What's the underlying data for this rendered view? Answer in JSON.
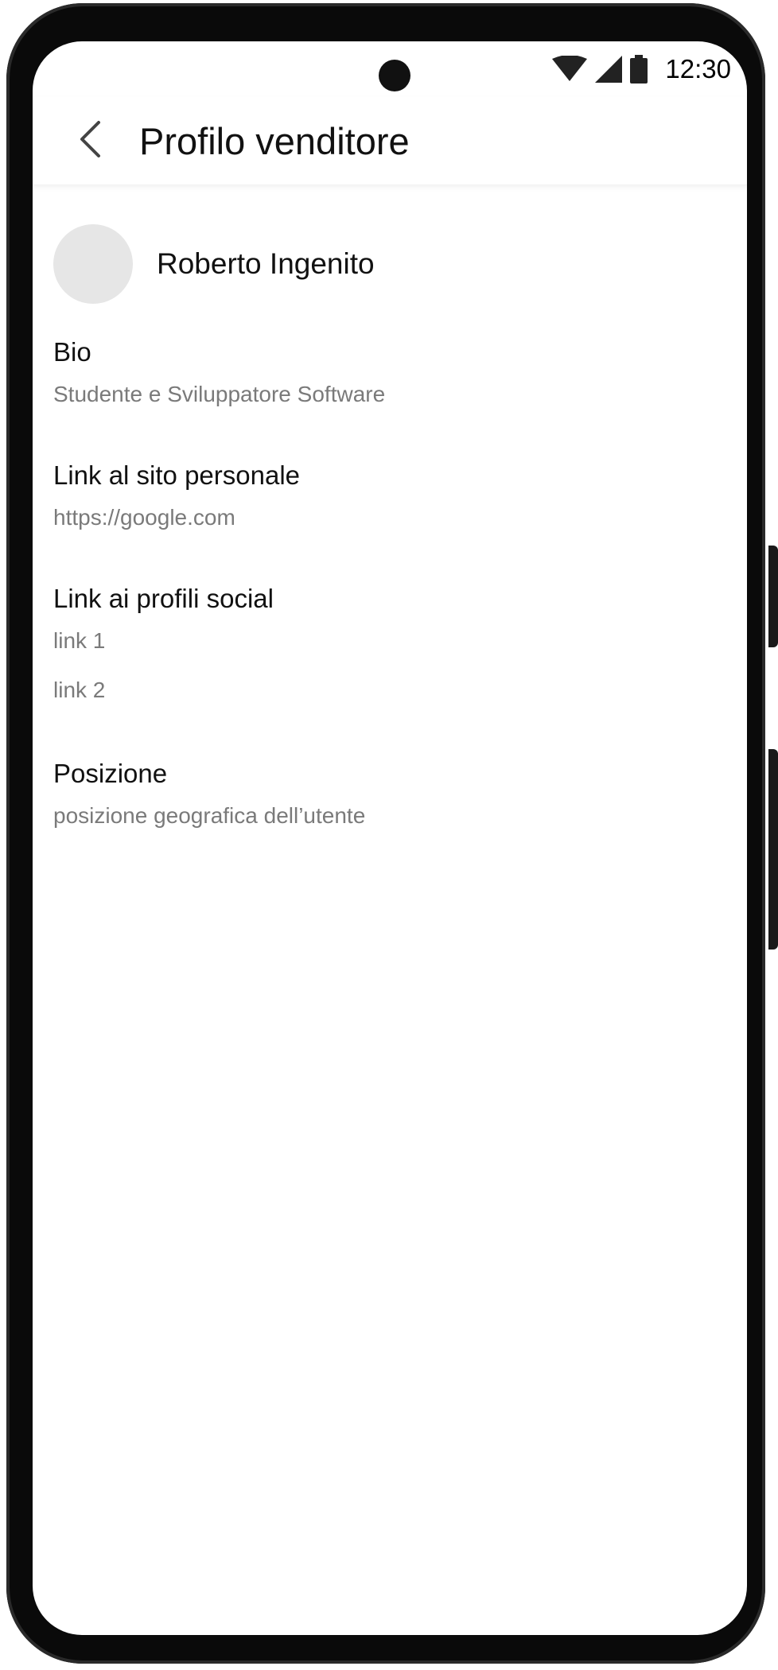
{
  "status_bar": {
    "time": "12:30",
    "icons": [
      "wifi-icon",
      "signal-icon",
      "battery-icon"
    ]
  },
  "app_bar": {
    "back_icon": "chevron-left-icon",
    "title": "Profilo venditore"
  },
  "profile": {
    "name": "Roberto Ingenito"
  },
  "sections": {
    "bio": {
      "heading": "Bio",
      "value": "Studente e Sviluppatore Software"
    },
    "website": {
      "heading": "Link al sito personale",
      "value": "https://google.com"
    },
    "social": {
      "heading": "Link ai profili social",
      "links": [
        "link 1",
        "link 2"
      ]
    },
    "location": {
      "heading": "Posizione",
      "value": "posizione geografica dell’utente"
    }
  },
  "colors": {
    "text_primary": "#111111",
    "text_secondary": "#7a7a7a",
    "avatar_placeholder": "#e6e6e6",
    "device_frame": "#0a0a0a"
  }
}
